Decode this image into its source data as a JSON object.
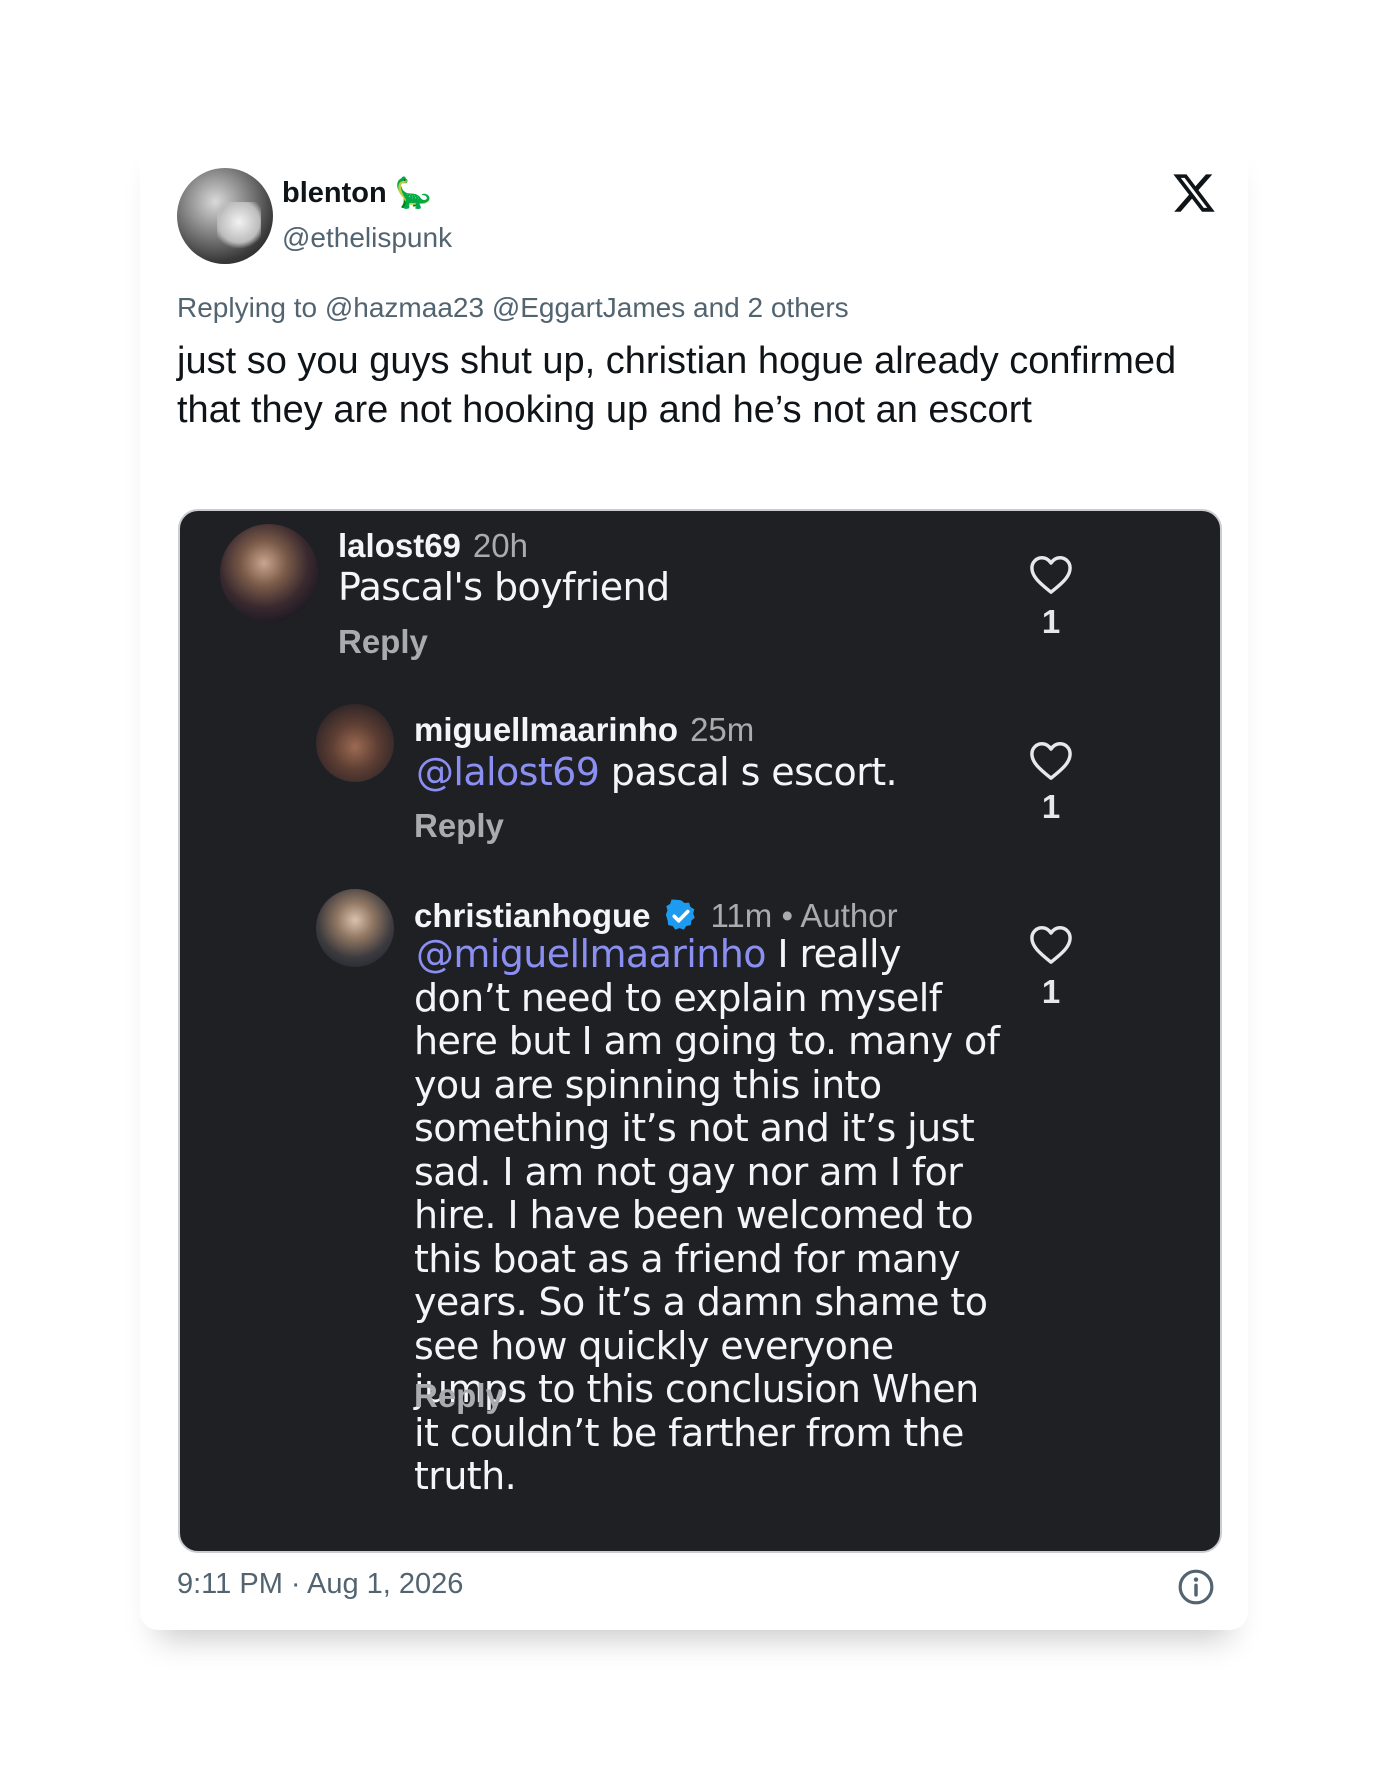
{
  "tweet": {
    "display_name": "blenton",
    "name_emoji": "🦕",
    "handle": "@ethelispunk",
    "replying_to": "Replying to @hazmaa23 @EggartJames and 2 others",
    "text": "just so you guys shut up, christian hogue already confirmed that they are not hooking up and he’s not an escort",
    "timestamp": "9:11 PM · Aug 1, 2026",
    "logo_icon": "x-logo-icon",
    "info_icon": "info-icon"
  },
  "screenshot": {
    "comments": [
      {
        "username": "lalost69",
        "meta": "20h",
        "mention": "",
        "text": "Pascal's boyfriend",
        "reply_label": "Reply",
        "like_count": "1"
      },
      {
        "username": "miguellmaarinho",
        "meta": "25m",
        "mention": "@lalost69",
        "text": " pascal s escort.",
        "reply_label": "Reply",
        "like_count": "1"
      },
      {
        "username": "christianhogue",
        "meta": "11m • Author",
        "verified": true,
        "mention": "@miguellmaarinho",
        "text": " I really don’t need to explain myself here but I am going to. many of you are spinning this into something it’s not and it’s just sad. I am not gay nor am I for hire. I have been welcomed to this boat as a friend for many years. So it’s a damn shame to see how quickly everyone jumps to this conclusion When it couldn’t be farther from the truth.",
        "reply_label": "Reply",
        "like_count": "1"
      }
    ],
    "colors": {
      "background": "#1f2024",
      "mention": "#8b8ff2",
      "verified": "#1d9bf0"
    }
  }
}
